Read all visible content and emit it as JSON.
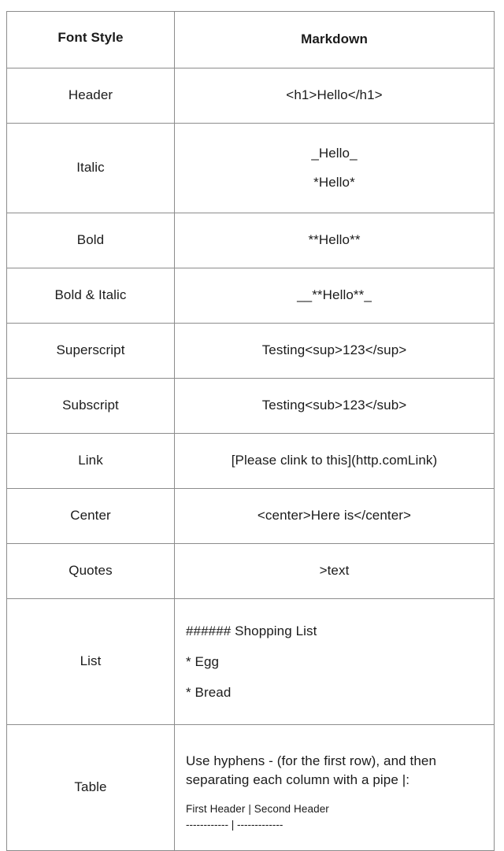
{
  "table": {
    "columns": [
      {
        "label": "Font Style"
      },
      {
        "label": "Markdown"
      }
    ],
    "rows": [
      {
        "style": "Header",
        "markdown": "<h1>Hello</h1>"
      },
      {
        "style": "Italic",
        "markdown_lines": [
          "_Hello_",
          "*Hello*"
        ]
      },
      {
        "style": "Bold",
        "markdown": "**Hello**"
      },
      {
        "style": "Bold & Italic",
        "markdown": "__**Hello**_"
      },
      {
        "style": "Superscript",
        "markdown": "Testing<sup>123</sup>"
      },
      {
        "style": "Subscript",
        "markdown": "Testing<sub>123</sub>"
      },
      {
        "style": "Link",
        "markdown": "[Please clink to this](http.comLink)"
      },
      {
        "style": "Center",
        "markdown": "<center>Here is</center>"
      },
      {
        "style": "Quotes",
        "markdown": ">text"
      },
      {
        "style": "List",
        "markdown_lines": [
          "###### Shopping List",
          "* Egg",
          "* Bread"
        ]
      },
      {
        "style": "Table",
        "description": "Use hyphens - (for the first row), and then separating each column with a pipe |:",
        "code_lines": [
          "First Header | Second Header",
          "------------ | -------------"
        ]
      }
    ]
  },
  "colors": {
    "border": "#8c8c8c",
    "text": "#1b1b1b",
    "background": "#ffffff"
  }
}
